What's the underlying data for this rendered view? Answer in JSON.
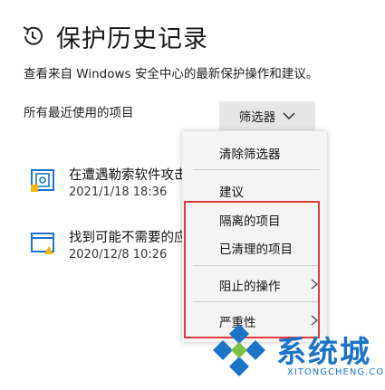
{
  "header": {
    "title": "保护历史记录",
    "subtitle": "查看来自 Windows 安全中心的最新保护操作和建议。",
    "section_label": "所有最近使用的项目",
    "icon": "history-clock-icon"
  },
  "filter": {
    "label": "筛选器",
    "icon": "chevron-down-icon"
  },
  "history_items": [
    {
      "title": "在遭遇勒索软件攻击",
      "time": "2021/1/18 18:36",
      "icon": "ransomware-protection-icon"
    },
    {
      "title": "找到可能不需要的应",
      "time": "2020/12/8 10:26",
      "icon": "warning-window-icon"
    }
  ],
  "filter_menu": {
    "clear": "清除筛选器",
    "recommendations": "建议",
    "quarantined": "隔离的项目",
    "cleaned": "已清理的项目",
    "blocked_actions": "阻止的操作",
    "severity": "严重性"
  },
  "watermark": {
    "text": "系统城",
    "sub": "XITONGCHENG.COM"
  },
  "colors": {
    "highlight": "#e03a3a",
    "icon_blue": "#1b74c8",
    "warning_yellow": "#f2b705"
  }
}
